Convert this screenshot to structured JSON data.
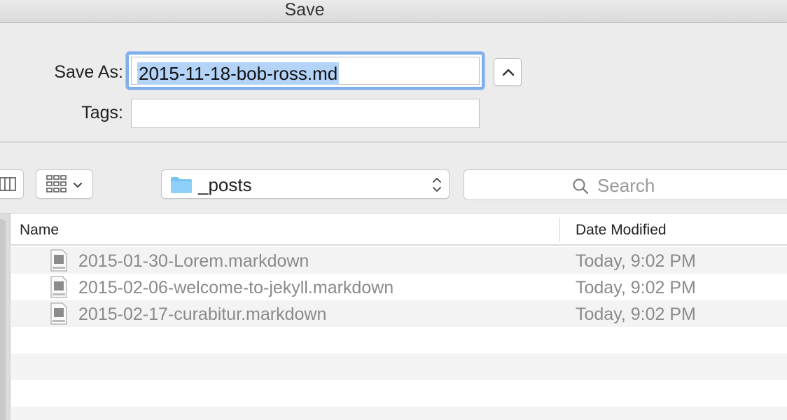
{
  "window": {
    "title": "Save"
  },
  "form": {
    "save_as_label": "Save As:",
    "save_as_value": "2015-11-18-bob-ross.md",
    "tags_label": "Tags:",
    "tags_value": ""
  },
  "toolbar": {
    "location": "_posts",
    "search_placeholder": "Search"
  },
  "file_list": {
    "columns": {
      "name": "Name",
      "date_modified": "Date Modified"
    },
    "rows": [
      {
        "icon": "markdown-file-icon",
        "name": "2015-01-30-Lorem.markdown",
        "date": "Today, 9:02 PM"
      },
      {
        "icon": "markdown-file-icon",
        "name": "2015-02-06-welcome-to-jekyll.markdown",
        "date": "Today, 9:02 PM"
      },
      {
        "icon": "markdown-file-icon",
        "name": "2015-02-17-curabitur.markdown",
        "date": "Today, 9:02 PM"
      }
    ]
  },
  "colors": {
    "selection": "#b3d3f8",
    "focus_ring": "#7fb0ea",
    "folder": "#76c4f4",
    "dimmed_text": "#8a8a8a"
  }
}
